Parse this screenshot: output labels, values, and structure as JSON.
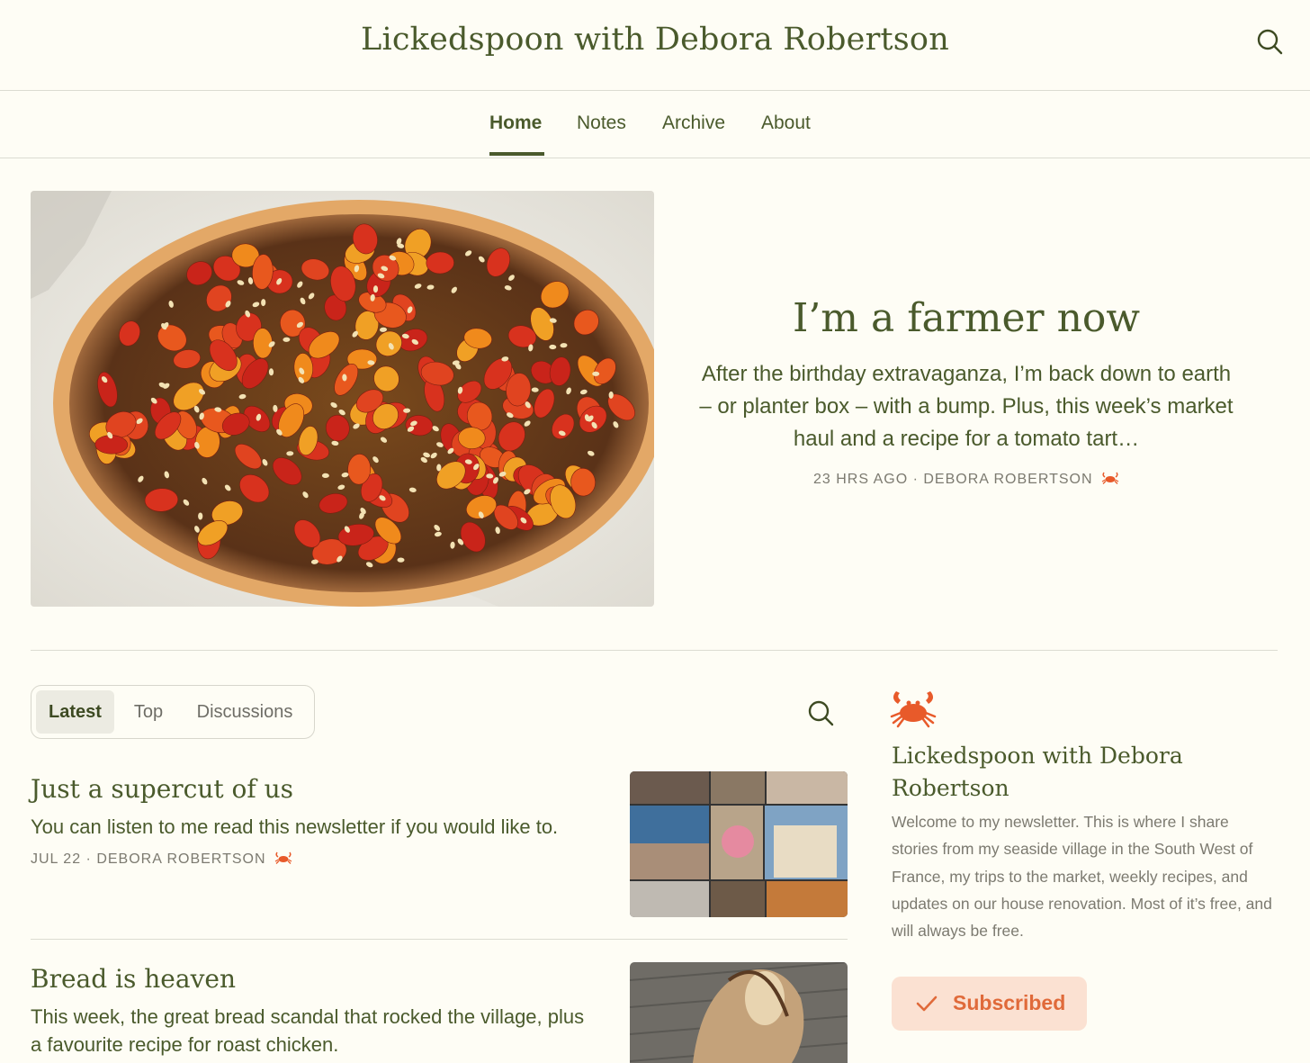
{
  "header": {
    "site_title": "Lickedspoon with Debora Robertson",
    "search_icon": "search-icon"
  },
  "nav": {
    "items": [
      {
        "label": "Home",
        "active": true
      },
      {
        "label": "Notes",
        "active": false
      },
      {
        "label": "Archive",
        "active": false
      },
      {
        "label": "About",
        "active": false
      }
    ]
  },
  "hero": {
    "title": "I’m a farmer now",
    "description": "After the birthday extravaganza, I’m back down to earth – or planter box – with a bump. Plus, this week’s market haul and a recipe for a tomato tart…",
    "meta": "23 HRS AGO · DEBORA ROBERTSON",
    "image_icon": "tomato-tart-photo"
  },
  "tabs": {
    "items": [
      {
        "label": "Latest",
        "active": true
      },
      {
        "label": "Top",
        "active": false
      },
      {
        "label": "Discussions",
        "active": false
      }
    ]
  },
  "posts": [
    {
      "title": "Just a supercut of us",
      "description": "You can listen to me read this newsletter if you would like to.",
      "meta": "JUL 22 · DEBORA ROBERTSON",
      "thumbnail": "photo-collage"
    },
    {
      "title": "Bread is heaven",
      "description": "This week, the great bread scandal that rocked the village, plus a favourite recipe for roast chicken.",
      "thumbnail": "bread-bag-photo"
    }
  ],
  "sidebar": {
    "logo_icon": "crab-icon",
    "title": "Lickedspoon with Debora Robertson",
    "description": "Welcome to my newsletter. This is where I share stories from my seaside village in the South West of France, my trips to the market, weekly recipes, and updates on our house renovation. Most of it’s free, and will always be free.",
    "subscribed_label": "Subscribed"
  },
  "colors": {
    "background": "#fefdf5",
    "primary_text": "#4a5a2c",
    "muted_text": "#7c7a70",
    "subscribed_bg": "#fbe1d2",
    "subscribed_text": "#e06a3a",
    "crab": "#e85a2a"
  }
}
